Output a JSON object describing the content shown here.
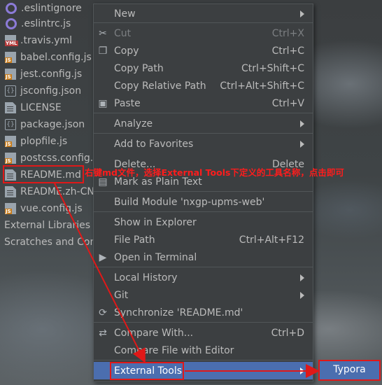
{
  "project_tree": {
    "items": [
      {
        "label": ".eslintignore",
        "icon": "eslint-icon",
        "kind": "ring"
      },
      {
        "label": ".eslintrc.js",
        "icon": "eslint-icon",
        "kind": "ring"
      },
      {
        "label": ".travis.yml",
        "icon": "yml-file-icon",
        "kind": "yml",
        "tag": "YML"
      },
      {
        "label": "babel.config.js",
        "icon": "js-file-icon",
        "kind": "js",
        "tag": "JS"
      },
      {
        "label": "jest.config.js",
        "icon": "js-file-icon",
        "kind": "js",
        "tag": "JS"
      },
      {
        "label": "jsconfig.json",
        "icon": "json-file-icon",
        "kind": "json"
      },
      {
        "label": "LICENSE",
        "icon": "text-file-icon",
        "kind": "file"
      },
      {
        "label": "package.json",
        "icon": "json-file-icon",
        "kind": "json"
      },
      {
        "label": "plopfile.js",
        "icon": "js-file-icon",
        "kind": "js",
        "tag": "JS"
      },
      {
        "label": "postcss.config.js",
        "icon": "js-file-icon",
        "kind": "js",
        "tag": "JS"
      },
      {
        "label": "README.md",
        "icon": "markdown-file-icon",
        "kind": "file"
      },
      {
        "label": "README.zh-CN.md",
        "icon": "markdown-file-icon",
        "kind": "file"
      },
      {
        "label": "vue.config.js",
        "icon": "js-file-icon",
        "kind": "js",
        "tag": "JS"
      }
    ],
    "external_libraries": "External Libraries",
    "scratches": "Scratches and Consoles"
  },
  "context_menu": {
    "items": [
      {
        "label": "New",
        "submenu": true
      },
      {
        "label": "Cut",
        "shortcut": "Ctrl+X",
        "icon": "scissors-icon",
        "disabled": true
      },
      {
        "label": "Copy",
        "shortcut": "Ctrl+C",
        "icon": "copy-icon"
      },
      {
        "label": "Copy Path",
        "shortcut": "Ctrl+Shift+C"
      },
      {
        "label": "Copy Relative Path",
        "shortcut": "Ctrl+Alt+Shift+C"
      },
      {
        "label": "Paste",
        "shortcut": "Ctrl+V",
        "icon": "paste-icon"
      },
      {
        "label": "Analyze",
        "submenu": true
      },
      {
        "label": "Add to Favorites",
        "submenu": true
      },
      {
        "label": "Delete...",
        "shortcut": "Delete"
      },
      {
        "label": "Mark as Plain Text",
        "icon": "text-file-icon"
      },
      {
        "label": "Build Module 'nxgp-upms-web'"
      },
      {
        "label": "Show in Explorer"
      },
      {
        "label": "File Path",
        "shortcut": "Ctrl+Alt+F12"
      },
      {
        "label": "Open in Terminal",
        "icon": "terminal-icon"
      },
      {
        "label": "Local History",
        "submenu": true
      },
      {
        "label": "Git",
        "submenu": true
      },
      {
        "label": "Synchronize 'README.md'",
        "icon": "sync-icon"
      },
      {
        "label": "Compare With...",
        "shortcut": "Ctrl+D",
        "icon": "compare-icon"
      },
      {
        "label": "Compare File with Editor"
      },
      {
        "label": "External Tools",
        "submenu": true,
        "selected": true
      }
    ]
  },
  "submenu": {
    "label": "Typora"
  },
  "annotation": {
    "text": "右键md文件，选择External Tools下定义的工具名称，点击即可",
    "color": "#ff1c1c"
  },
  "colors": {
    "menu_bg": "#3c3f41",
    "selection": "#4b6eaf",
    "highlight_red": "#e01818"
  }
}
